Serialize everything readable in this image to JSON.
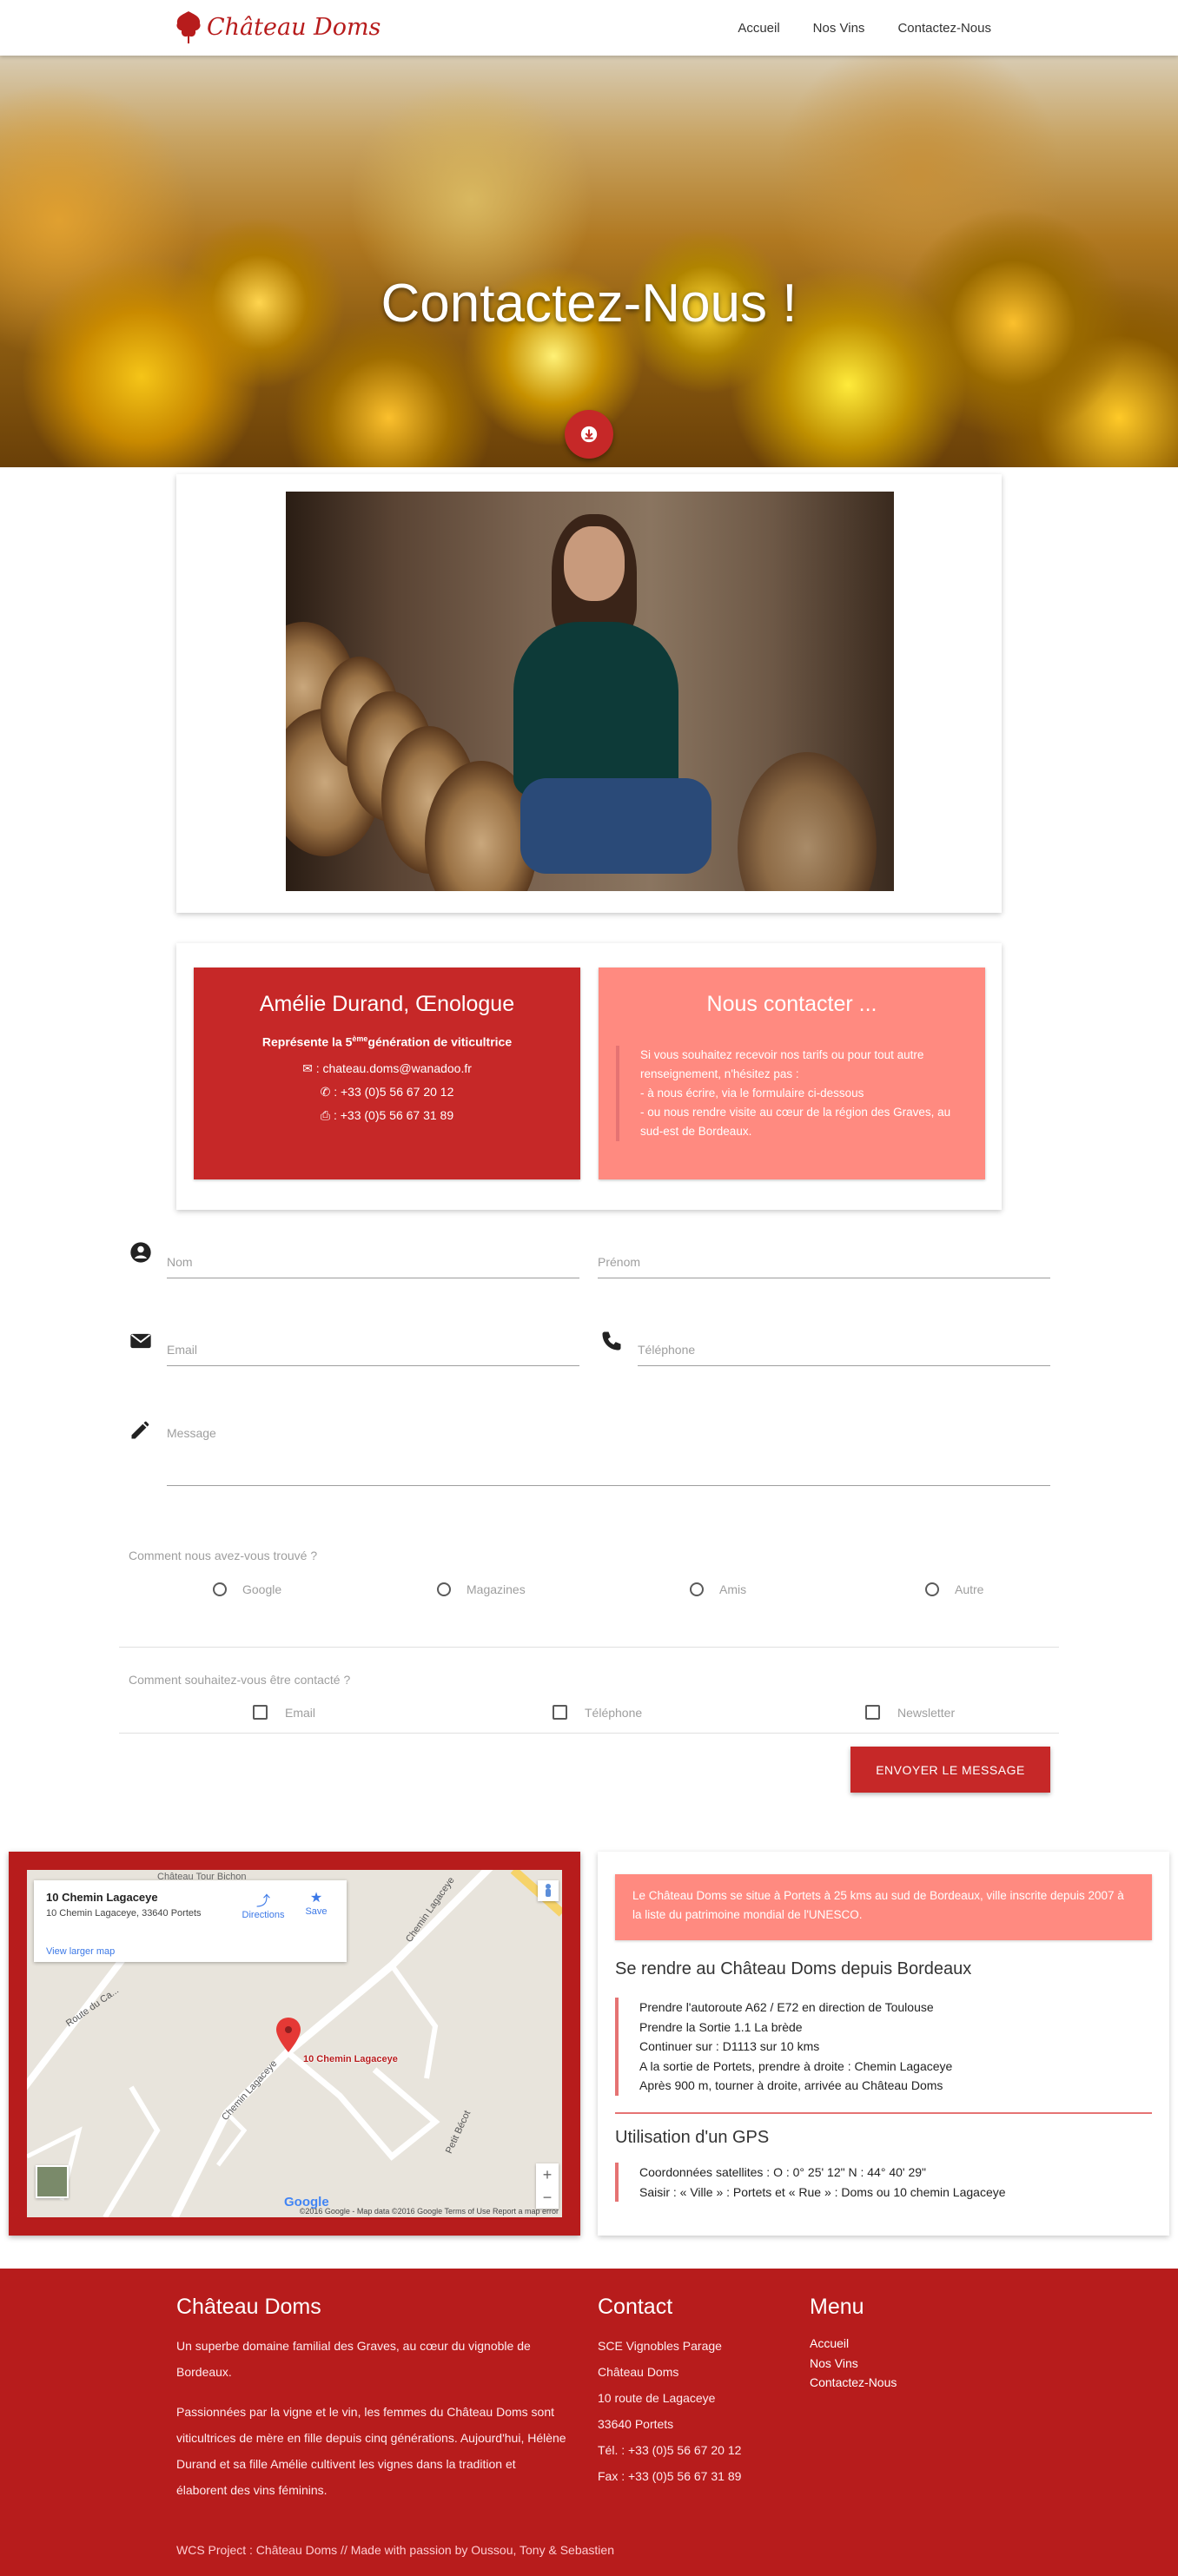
{
  "brand": {
    "name": "Château Doms",
    "accent": "#c62828",
    "accent_dark": "#b71c1c",
    "salmon": "#ff8a80"
  },
  "nav": {
    "items": [
      "Accueil",
      "Nos Vins",
      "Contactez-Nous"
    ]
  },
  "hero": {
    "title": "Contactez-Nous !",
    "button_icon": "download-icon"
  },
  "contact_card": {
    "name": "Amélie Durand, Œnologue",
    "represent_prefix": "Représente la 5",
    "represent_sup": "ème",
    "represent_suffix": "génération de viticultrice",
    "email": " : chateau.doms@wanadoo.fr",
    "phone": " : +33 (0)5 56 67 20 12",
    "fax": " : +33 (0)5 56 67 31 89"
  },
  "contact_us": {
    "title": "Nous contacter ...",
    "text1": "Si vous souhaitez recevoir nos tarifs ou pour tout autre renseignement, n'hésitez pas :",
    "text2": "- à nous écrire, via le formulaire ci-dessous",
    "text3": "- ou nous rendre visite au cœur de la région des Graves, au sud-est de Bordeaux."
  },
  "form": {
    "nom": "Nom",
    "prenom": "Prénom",
    "email": "Email",
    "telephone": "Téléphone",
    "message": "Message",
    "found_question": "Comment nous avez-vous trouvé ?",
    "found_options": [
      "Google",
      "Magazines",
      "Amis",
      "Autre"
    ],
    "contact_question": "Comment souhaitez-vous être contacté ?",
    "contact_options": [
      "Email",
      "Téléphone",
      "Newsletter"
    ],
    "submit": "ENVOYER LE MESSAGE"
  },
  "map": {
    "title": "10 Chemin Lagaceye",
    "address": "10 Chemin Lagaceye, 33640 Portets",
    "directions": "Directions",
    "save": "Save",
    "larger": "View larger map",
    "pin_label": "10 Chemin Lagaceye",
    "road1": "Route du Ca...",
    "road2": "Chemin Lagaceye",
    "road3": "Chemin Lagaceye",
    "road4": "Petit Bécot",
    "road5": "Château Tour Bichon",
    "google": "Google",
    "footer": "©2016 Google - Map data ©2016 Google    Terms of Use    Report a map error"
  },
  "directions": {
    "note": "Le Château Doms se situe à Portets à 25 kms au sud de Bordeaux, ville inscrite depuis 2007 à la liste du patrimoine mondial de l'UNESCO.",
    "heading1": "Se rendre au Château Doms depuis Bordeaux",
    "steps": [
      "Prendre l'autoroute A62 / E72 en direction de Toulouse",
      "Prendre la Sortie 1.1 La brède",
      "Continuer sur : D1113 sur 10 kms",
      "A la sortie de Portets, prendre à droite : Chemin Lagaceye",
      "Après 900 m, tourner à droite, arrivée au Château Doms"
    ],
    "heading2": "Utilisation d'un GPS",
    "gps": [
      "Coordonnées satellites : O : 0° 25' 12\" N : 44° 40' 29\"",
      "Saisir : « Ville » : Portets et « Rue » : Doms ou 10 chemin Lagaceye"
    ]
  },
  "footer": {
    "about_title": "Château Doms",
    "about_p1": "Un superbe domaine familial des Graves, au cœur du vignoble de Bordeaux.",
    "about_p2": "Passionnées par la vigne et le vin, les femmes du Château Doms sont viticultrices de mère en fille depuis cinq générations. Aujourd'hui, Hélène Durand et sa fille Amélie cultivent les vignes dans la tradition et élaborent des vins féminins.",
    "contact_title": "Contact",
    "contact_lines": [
      "SCE Vignobles Parage",
      "Château Doms",
      "10 route de Lagaceye",
      "33640 Portets",
      "Tél. : +33 (0)5 56 67 20 12",
      "Fax : +33 (0)5 56 67 31 89"
    ],
    "menu_title": "Menu",
    "menu_items": [
      "Accueil",
      "Nos Vins",
      "Contactez-Nous"
    ],
    "copyright": "WCS Project : Château Doms // Made with passion by Oussou, Tony & Sebastien"
  }
}
